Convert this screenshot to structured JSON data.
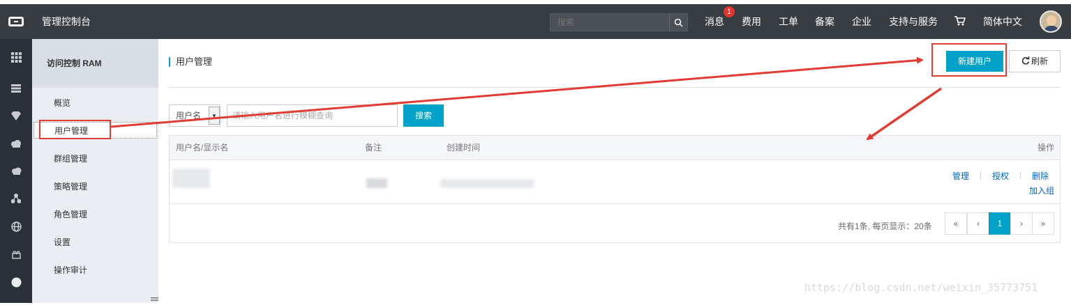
{
  "topbar": {
    "brand": "管理控制台",
    "search_placeholder": "搜索",
    "nav": [
      "消息",
      "费用",
      "工单",
      "备案",
      "企业",
      "支持与服务",
      "简体中文"
    ],
    "message_badge": "1",
    "accent_color": "#00a2ca",
    "icons": [
      "aliyun-logo-icon",
      "search-icon",
      "cart-icon",
      "avatar"
    ]
  },
  "rail": {
    "icons": [
      "grid-icon",
      "server-icon",
      "shield-icon",
      "cloud-icon",
      "cloud-upload-icon",
      "network-icon",
      "globe-icon",
      "gift-icon",
      "circle-icon"
    ]
  },
  "sidebar": {
    "header": "访问控制 RAM",
    "items": [
      {
        "label": "概览"
      },
      {
        "label": "用户管理"
      },
      {
        "label": "群组管理"
      },
      {
        "label": "策略管理"
      },
      {
        "label": "角色管理"
      },
      {
        "label": "设置"
      },
      {
        "label": "操作审计"
      }
    ],
    "active_index": 1
  },
  "main": {
    "title": "用户管理",
    "new_user_label": "新建用户",
    "refresh_label": "刷新",
    "filter_select": "用户名",
    "query_placeholder": "请输入用户名进行模糊查询",
    "search_label": "搜索",
    "columns": [
      "用户名/显示名",
      "备注",
      "创建时间",
      "操作"
    ],
    "row_actions": [
      "管理",
      "授权",
      "删除",
      "加入组"
    ],
    "summary": "共有1条, 每页显示：20条",
    "pagination": [
      "«",
      "‹",
      "1",
      "›",
      "»"
    ],
    "current_page": "1"
  },
  "watermark": "https://blog.csdn.net/weixin_35773751",
  "annotation_color": "#e23b33"
}
